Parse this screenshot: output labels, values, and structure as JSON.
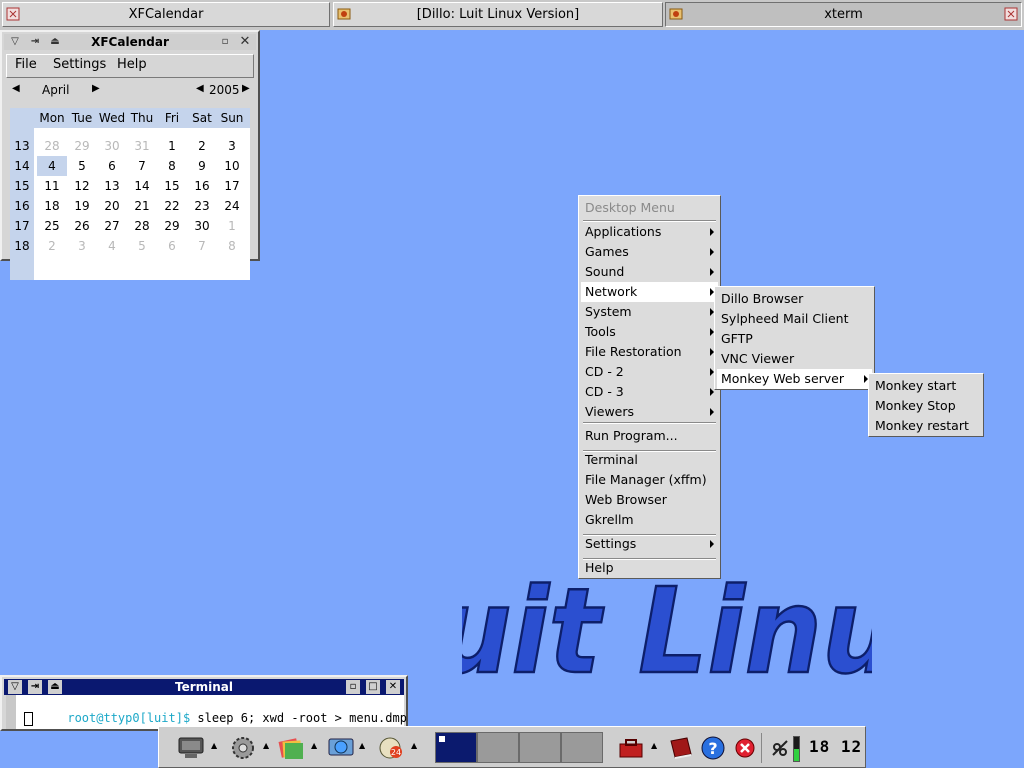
{
  "taskbar": {
    "tasks": [
      "XFCalendar",
      "[Dillo: Luit Linux Version]",
      "xterm"
    ]
  },
  "calendar": {
    "title": "XFCalendar",
    "menu": [
      "File",
      "Settings",
      "Help"
    ],
    "month": "April",
    "year": "2005",
    "weekdays": [
      "Mon",
      "Tue",
      "Wed",
      "Thu",
      "Fri",
      "Sat",
      "Sun"
    ],
    "weeks": [
      "13",
      "14",
      "15",
      "16",
      "17",
      "18"
    ],
    "days": [
      [
        "28",
        "29",
        "30",
        "31",
        "1",
        "2",
        "3"
      ],
      [
        "4",
        "5",
        "6",
        "7",
        "8",
        "9",
        "10"
      ],
      [
        "11",
        "12",
        "13",
        "14",
        "15",
        "16",
        "17"
      ],
      [
        "18",
        "19",
        "20",
        "21",
        "22",
        "23",
        "24"
      ],
      [
        "25",
        "26",
        "27",
        "28",
        "29",
        "30",
        "1"
      ],
      [
        "2",
        "3",
        "4",
        "5",
        "6",
        "7",
        "8"
      ]
    ],
    "selected_day": "4"
  },
  "desktop_menu": {
    "title": "Desktop Menu",
    "items": [
      "Applications",
      "Games",
      "Sound",
      "Network",
      "System",
      "Tools",
      "File Restoration",
      "CD - 2",
      "CD - 3",
      "Viewers"
    ],
    "run": "Run Program...",
    "apps": [
      "Terminal",
      "File Manager (xffm)",
      "Web Browser",
      "Gkrellm"
    ],
    "settings": "Settings",
    "help": "Help"
  },
  "network_menu": {
    "items": [
      "Dillo Browser",
      "Sylpheed Mail Client",
      "GFTP",
      "VNC Viewer",
      "Monkey Web server"
    ]
  },
  "monkey_menu": {
    "items": [
      "Monkey start",
      "Monkey Stop",
      "Monkey restart"
    ]
  },
  "logo": {
    "text": "Luit Linux"
  },
  "terminal": {
    "title": "Terminal",
    "prompt": "root@ttyp0[luit]$",
    "command": " sleep 6; xwd -root > menu.dmp"
  },
  "panel": {
    "clock": "18 12",
    "icons": [
      "monitor-icon",
      "gear-icon",
      "files-icon",
      "globe-icon",
      "clock-icon",
      "toolbox-icon",
      "book-icon",
      "help-icon",
      "stop-icon",
      "antenna-icon"
    ]
  },
  "colors": {
    "desktop": "#7ca6fc",
    "accent": "#0a1870",
    "highlight": "#c5d4ec"
  }
}
